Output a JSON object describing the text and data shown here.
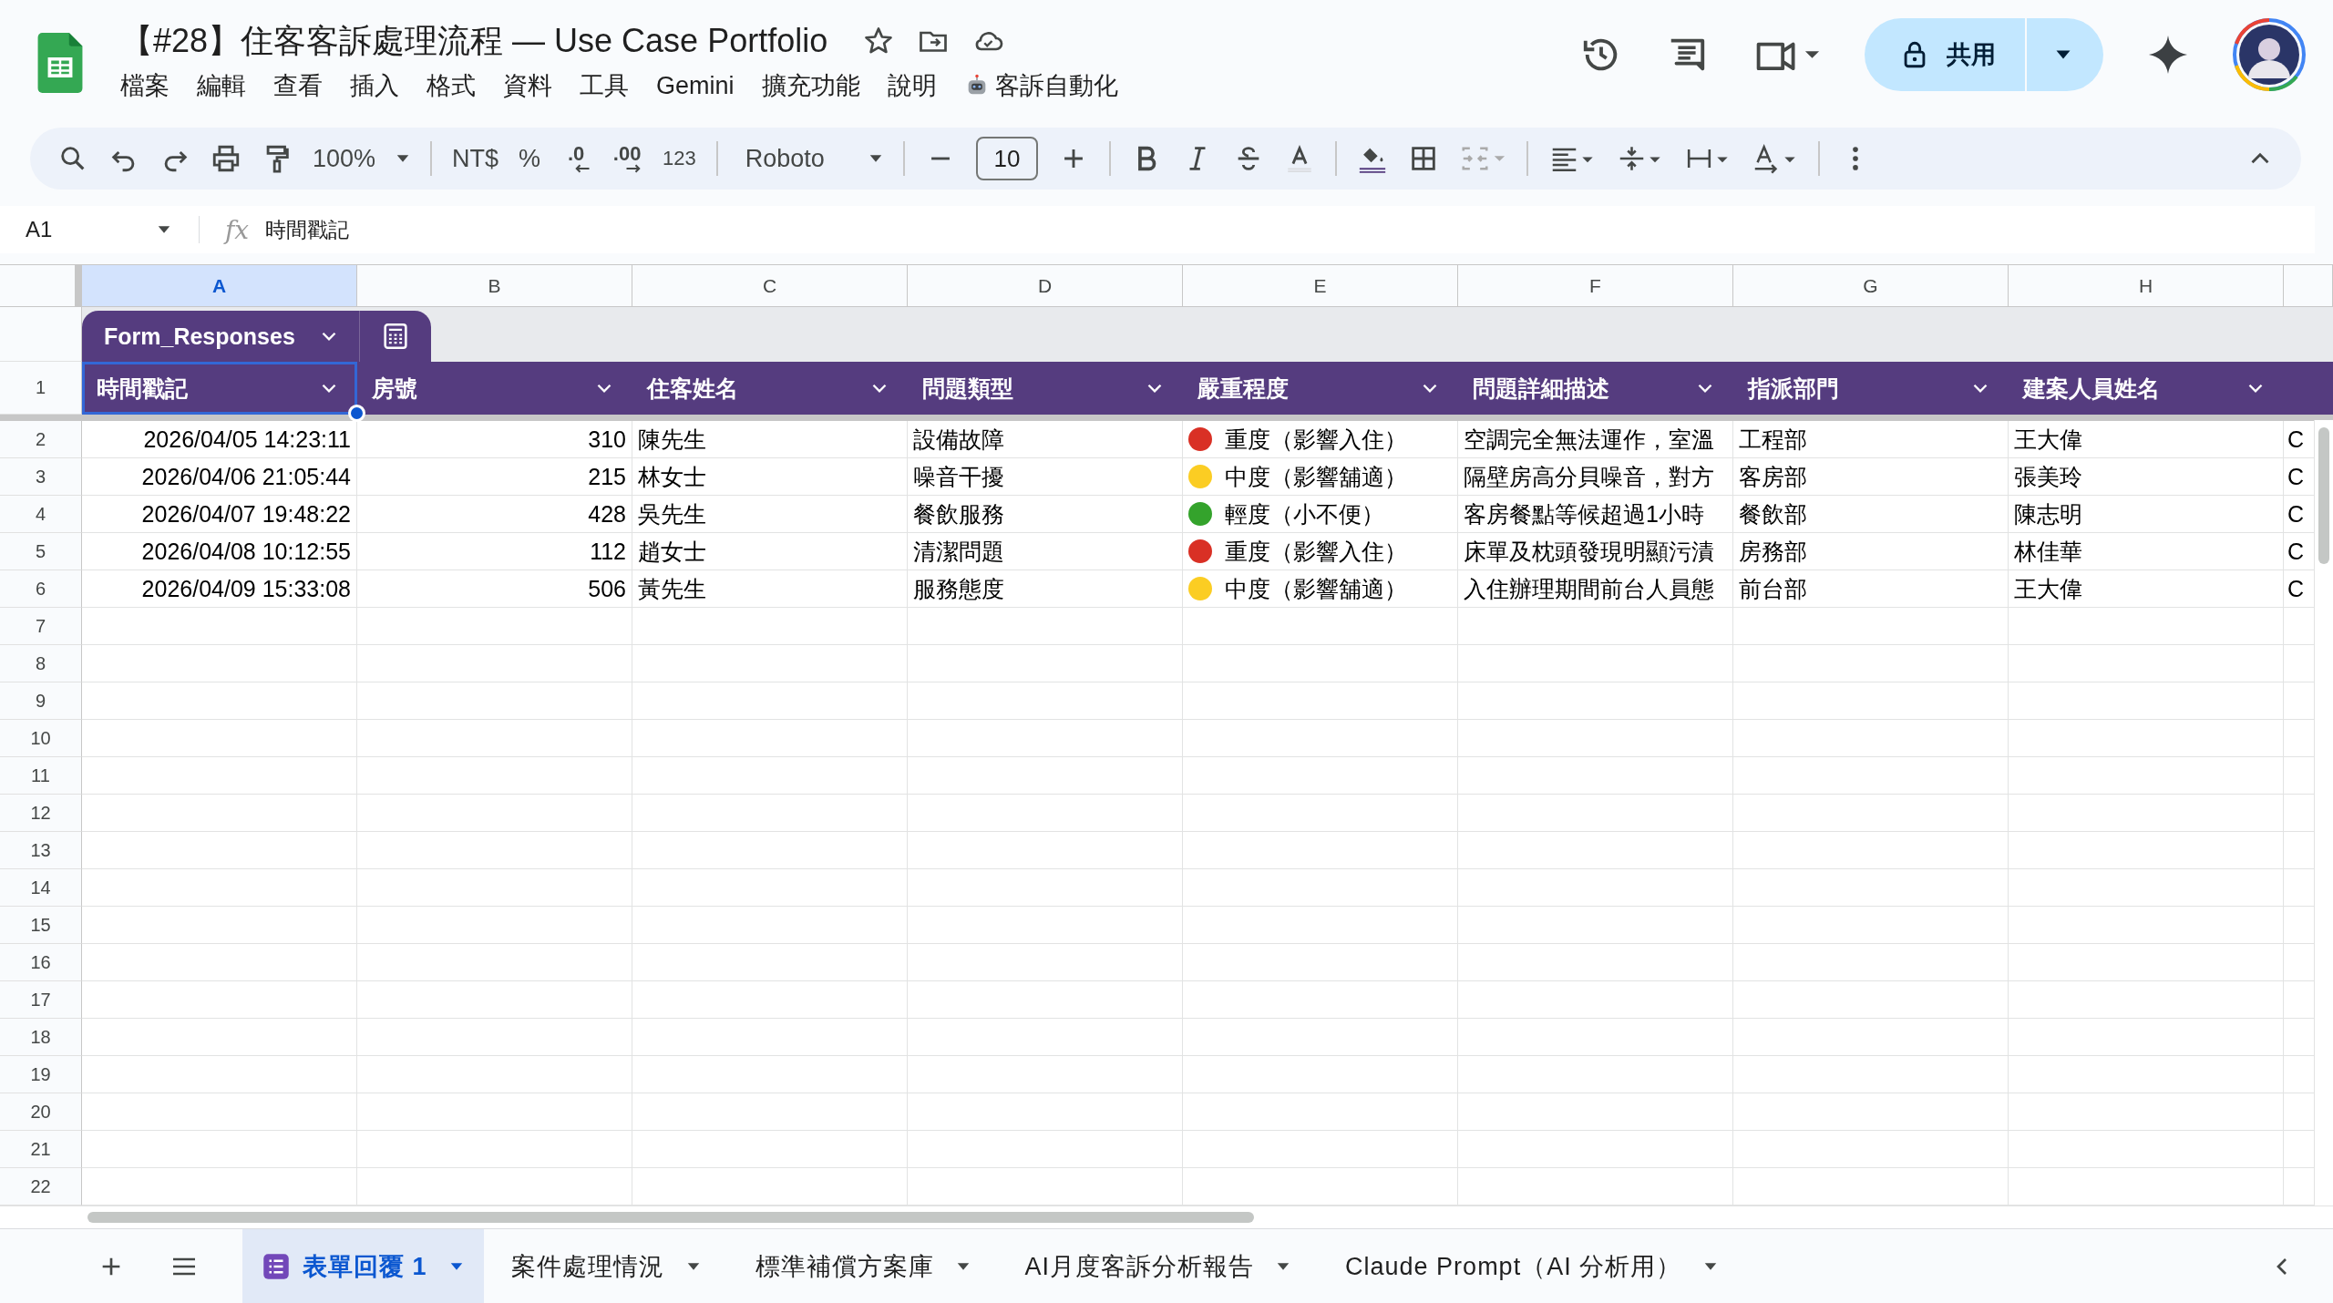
{
  "doc": {
    "title": "【#28】住客客訴處理流程 — Use Case Portfolio"
  },
  "menu": [
    {
      "label": "檔案",
      "kind": "plain"
    },
    {
      "label": "編輯",
      "kind": "plain"
    },
    {
      "label": "查看",
      "kind": "plain"
    },
    {
      "label": "插入",
      "kind": "plain"
    },
    {
      "label": "格式",
      "kind": "plain"
    },
    {
      "label": "資料",
      "kind": "plain"
    },
    {
      "label": "工具",
      "kind": "plain"
    },
    {
      "label": "Gemini",
      "kind": "plain"
    },
    {
      "label": "擴充功能",
      "kind": "plain"
    },
    {
      "label": "說明",
      "kind": "plain"
    },
    {
      "label": "客訴自動化",
      "kind": "robot"
    }
  ],
  "share_button": {
    "label": "共用"
  },
  "toolbar": {
    "zoom": "100%",
    "currency": "NT$",
    "percent": "%",
    "decrease_decimals": ".0",
    "increase_decimals": ".00",
    "number_format": "123",
    "font": "Roboto",
    "font_size": "10"
  },
  "formula_bar": {
    "cell_ref": "A1",
    "fx": "fx",
    "value": "時間戳記"
  },
  "column_letters": [
    {
      "label": "A",
      "selected": true
    },
    {
      "label": "B",
      "selected": false
    },
    {
      "label": "C",
      "selected": false
    },
    {
      "label": "D",
      "selected": false
    },
    {
      "label": "E",
      "selected": false
    },
    {
      "label": "F",
      "selected": false
    },
    {
      "label": "G",
      "selected": false
    },
    {
      "label": "H",
      "selected": false
    }
  ],
  "table": {
    "name": "Form_Responses",
    "header_row_number": "1",
    "columns": [
      {
        "label": "時間戳記",
        "selected": true
      },
      {
        "label": "房號",
        "selected": false
      },
      {
        "label": "住客姓名",
        "selected": false
      },
      {
        "label": "問題類型",
        "selected": false
      },
      {
        "label": "嚴重程度",
        "selected": false
      },
      {
        "label": "問題詳細描述",
        "selected": false
      },
      {
        "label": "指派部門",
        "selected": false
      },
      {
        "label": "建案人員姓名",
        "selected": false
      }
    ],
    "rows": [
      {
        "number": "2",
        "timestamp": "2026/04/05 14:23:11",
        "room": "310",
        "guest": "陳先生",
        "issue_type": "設備故障",
        "severity": {
          "label": "重度（影響入住）",
          "color": "#d93025"
        },
        "description": "空調完全無法運作，室溫",
        "department": "工程部",
        "creator": "王大偉",
        "column_9": "C"
      },
      {
        "number": "3",
        "timestamp": "2026/04/06 21:05:44",
        "room": "215",
        "guest": "林女士",
        "issue_type": "噪音干擾",
        "severity": {
          "label": "中度（影響舖適）",
          "color": "#fbcd23"
        },
        "description": "隔壁房高分貝噪音，對方",
        "department": "客房部",
        "creator": "張美玲",
        "column_9": "C"
      },
      {
        "number": "4",
        "timestamp": "2026/04/07 19:48:22",
        "room": "428",
        "guest": "吳先生",
        "issue_type": "餐飲服務",
        "severity": {
          "label": "輕度（小不便）",
          "color": "#34a32c"
        },
        "description": "客房餐點等候超過1小時",
        "department": "餐飲部",
        "creator": "陳志明",
        "column_9": "C"
      },
      {
        "number": "5",
        "timestamp": "2026/04/08 10:12:55",
        "room": "112",
        "guest": "趙女士",
        "issue_type": "清潔問題",
        "severity": {
          "label": "重度（影響入住）",
          "color": "#d93025"
        },
        "description": "床單及枕頭發現明顯污漬",
        "department": "房務部",
        "creator": "林佳華",
        "column_9": "C"
      },
      {
        "number": "6",
        "timestamp": "2026/04/09 15:33:08",
        "room": "506",
        "guest": "黃先生",
        "issue_type": "服務態度",
        "severity": {
          "label": "中度（影響舖適）",
          "color": "#fbcd23"
        },
        "description": "入住辦理期間前台人員態",
        "department": "前台部",
        "creator": "王大偉",
        "column_9": "C"
      }
    ],
    "empty_row_numbers": [
      "7",
      "8",
      "9",
      "10",
      "11",
      "12",
      "13",
      "14",
      "15",
      "16",
      "17",
      "18",
      "19",
      "20",
      "21",
      "22"
    ]
  },
  "sheet_tabs": [
    {
      "label": "表單回覆 1",
      "selected": true
    },
    {
      "label": "案件處理情況",
      "selected": false
    },
    {
      "label": "標準補償方案庫",
      "selected": false
    },
    {
      "label": "AI月度客訴分析報告",
      "selected": false
    },
    {
      "label": "Claude Prompt（AI 分析用）",
      "selected": false
    }
  ]
}
